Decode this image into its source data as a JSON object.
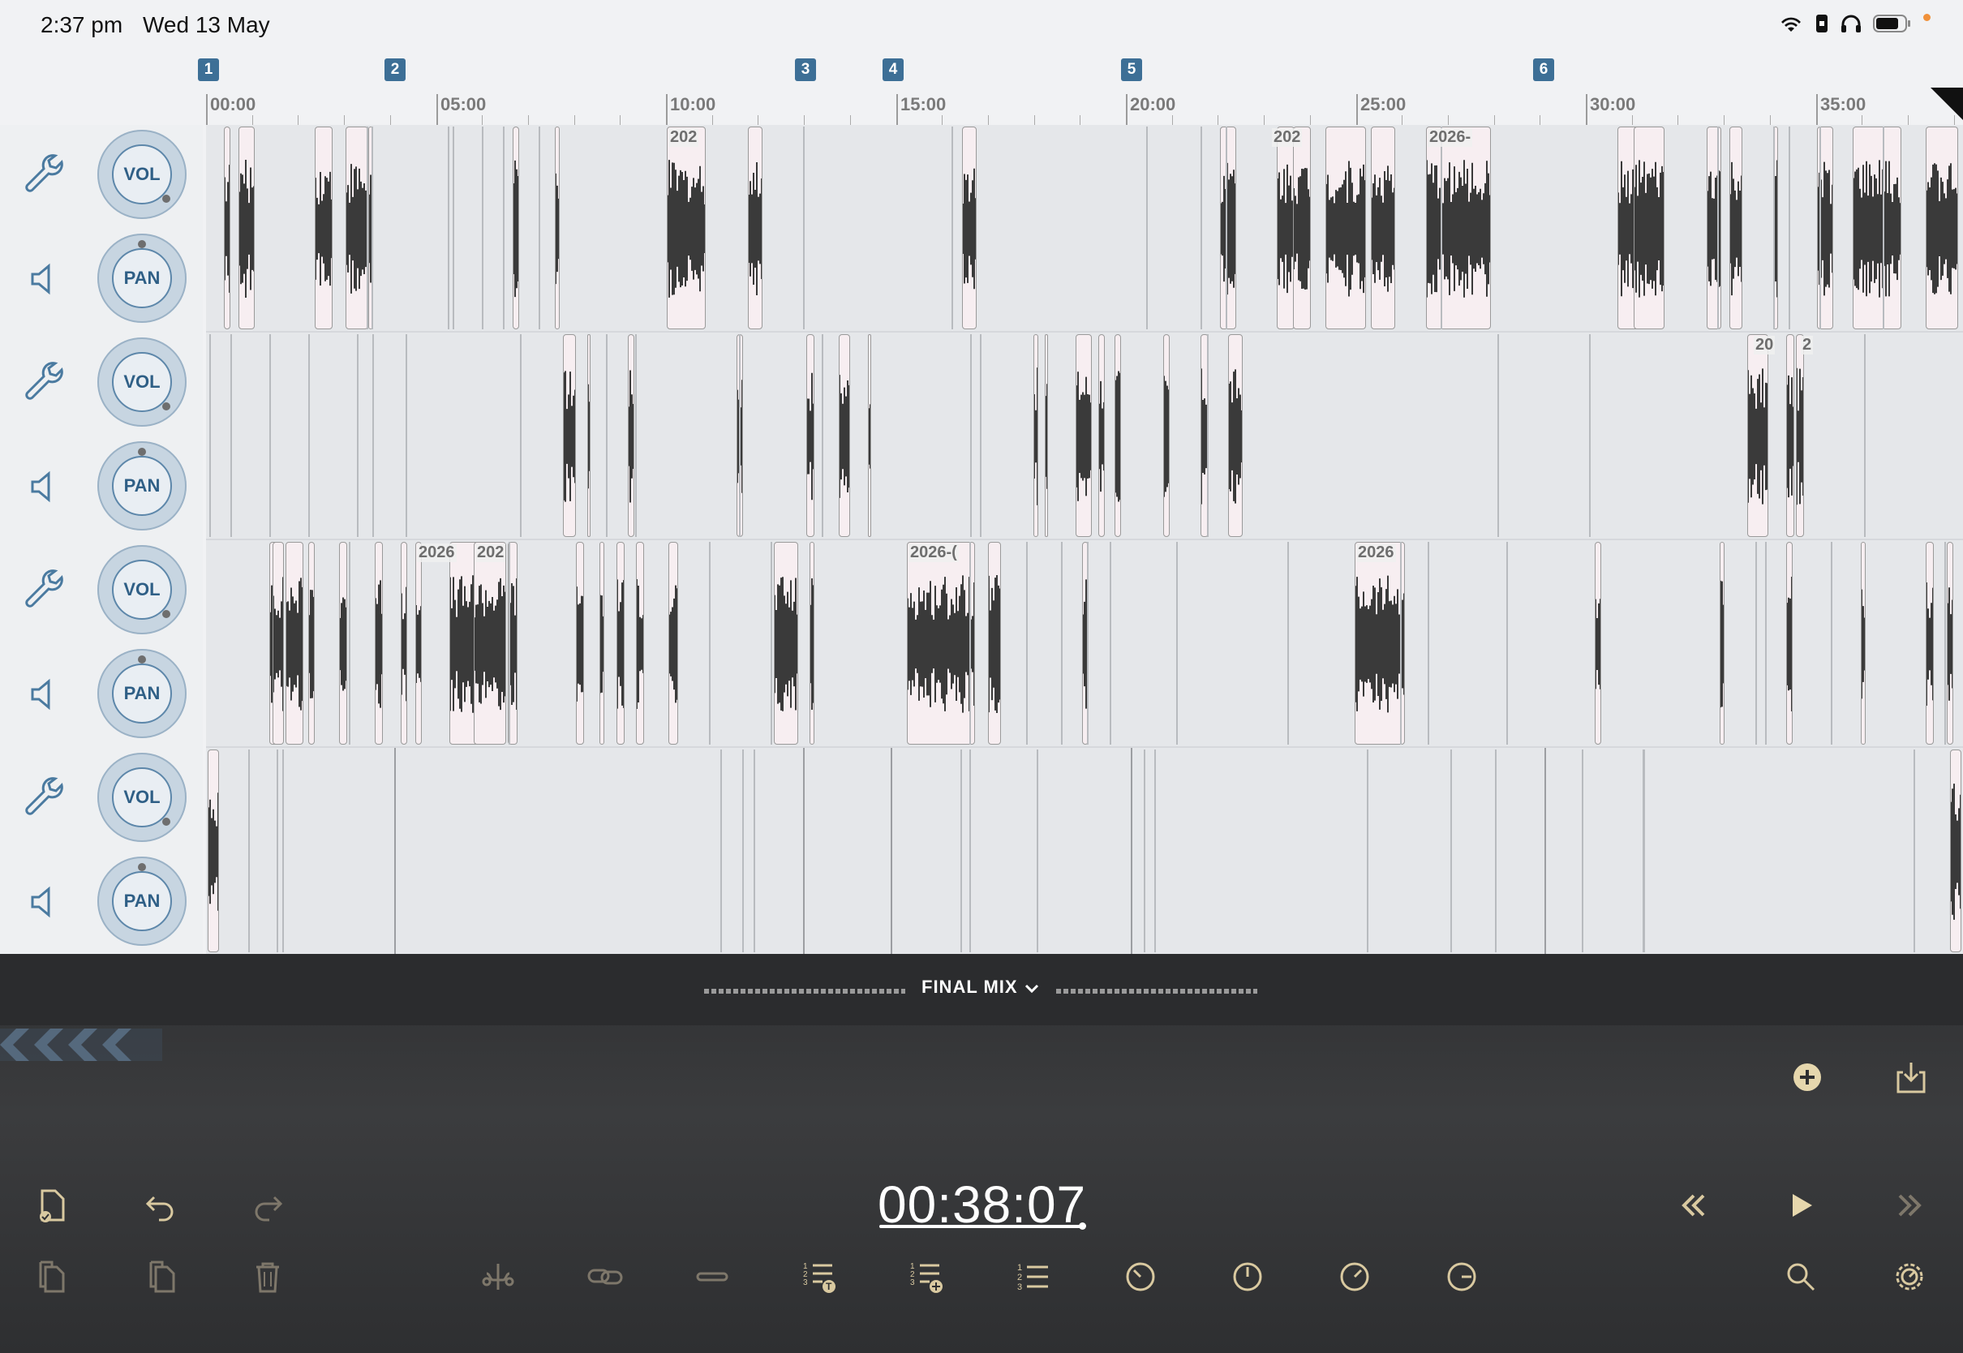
{
  "status_bar": {
    "time": "2:37 pm",
    "date": "Wed 13 May"
  },
  "markers": [
    "1",
    "2",
    "3",
    "4",
    "5",
    "6"
  ],
  "ruler_ticks": [
    "00:00",
    "05:00",
    "10:00",
    "15:00",
    "20:00",
    "25:00",
    "30:00",
    "35:00"
  ],
  "track_controls": {
    "vol_label": "VOL",
    "pan_label": "PAN"
  },
  "clip_labels": {
    "t1": [
      "202",
      "202",
      "2026-"
    ],
    "t2": [
      "20",
      "2"
    ],
    "t3": [
      "2026",
      "202",
      "2026-(",
      "2026"
    ]
  },
  "mix": {
    "title": "FINAL MIX"
  },
  "transport": {
    "timecode": "00:38:07"
  },
  "colors": {
    "accent": "#3d6f96",
    "icon_gold": "#d9c9a0",
    "panel_dark": "#2f3032"
  },
  "icons": [
    "wrench-icon",
    "speaker-icon",
    "document-check-icon",
    "undo-icon",
    "redo-icon",
    "copy-icon",
    "paste-icon",
    "trash-icon",
    "split-icon",
    "link-icon",
    "join-icon",
    "list-title-icon",
    "list-add-icon",
    "numbered-list-icon",
    "gauge-icon",
    "gauge-icon",
    "gauge-icon",
    "gauge-icon",
    "add-circle-icon",
    "download-icon",
    "rewind-icon",
    "play-icon",
    "fast-forward-icon",
    "search-icon",
    "gear-icon"
  ]
}
